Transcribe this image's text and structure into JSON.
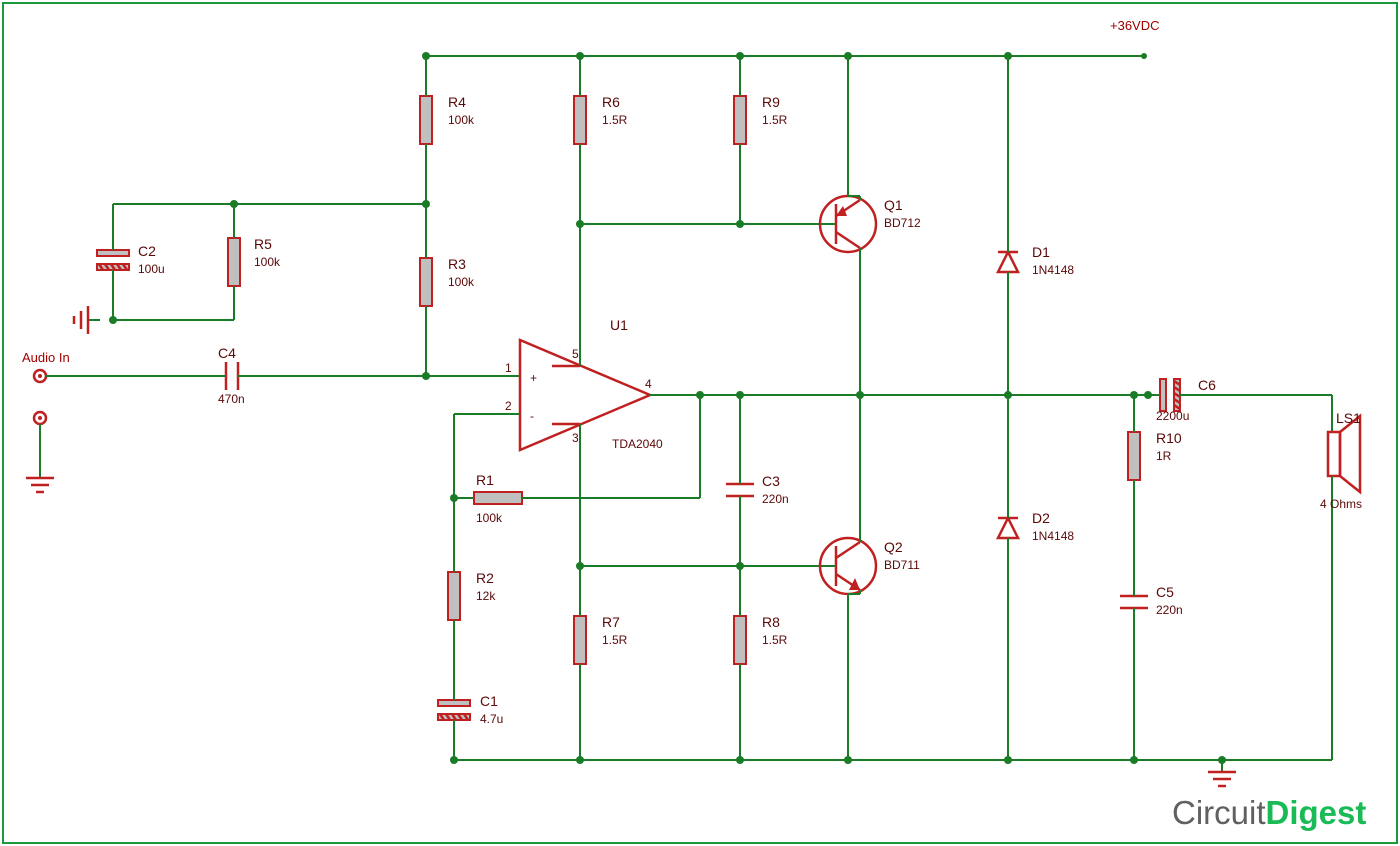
{
  "rails": {
    "vcc": "+36VDC"
  },
  "io": {
    "in": "Audio In"
  },
  "ic": {
    "u1": "U1",
    "u1pn": "TDA2040",
    "p1": "1",
    "p2": "2",
    "p3": "3",
    "p4": "4",
    "p5": "5",
    "plus": "+",
    "minus": "-"
  },
  "res": {
    "R1": {
      "name": "R1",
      "val": "100k"
    },
    "R2": {
      "name": "R2",
      "val": "12k"
    },
    "R3": {
      "name": "R3",
      "val": "100k"
    },
    "R4": {
      "name": "R4",
      "val": "100k"
    },
    "R5": {
      "name": "R5",
      "val": "100k"
    },
    "R6": {
      "name": "R6",
      "val": "1.5R"
    },
    "R7": {
      "name": "R7",
      "val": "1.5R"
    },
    "R8": {
      "name": "R8",
      "val": "1.5R"
    },
    "R9": {
      "name": "R9",
      "val": "1.5R"
    },
    "R10": {
      "name": "R10",
      "val": "1R"
    }
  },
  "cap": {
    "C1": {
      "name": "C1",
      "val": "4.7u"
    },
    "C2": {
      "name": "C2",
      "val": "100u"
    },
    "C3": {
      "name": "C3",
      "val": "220n"
    },
    "C4": {
      "name": "C4",
      "val": "470n"
    },
    "C5": {
      "name": "C5",
      "val": "220n"
    },
    "C6": {
      "name": "C6",
      "val": "2200u"
    }
  },
  "trans": {
    "Q1": {
      "name": "Q1",
      "pn": "BD712"
    },
    "Q2": {
      "name": "Q2",
      "pn": "BD711"
    }
  },
  "diode": {
    "D1": {
      "name": "D1",
      "pn": "1N4148"
    },
    "D2": {
      "name": "D2",
      "pn": "1N4148"
    }
  },
  "spk": {
    "ls1": "LS1",
    "ls1v": "4 Ohms"
  },
  "logo": {
    "a": "Circuit",
    "b": "Digest"
  }
}
